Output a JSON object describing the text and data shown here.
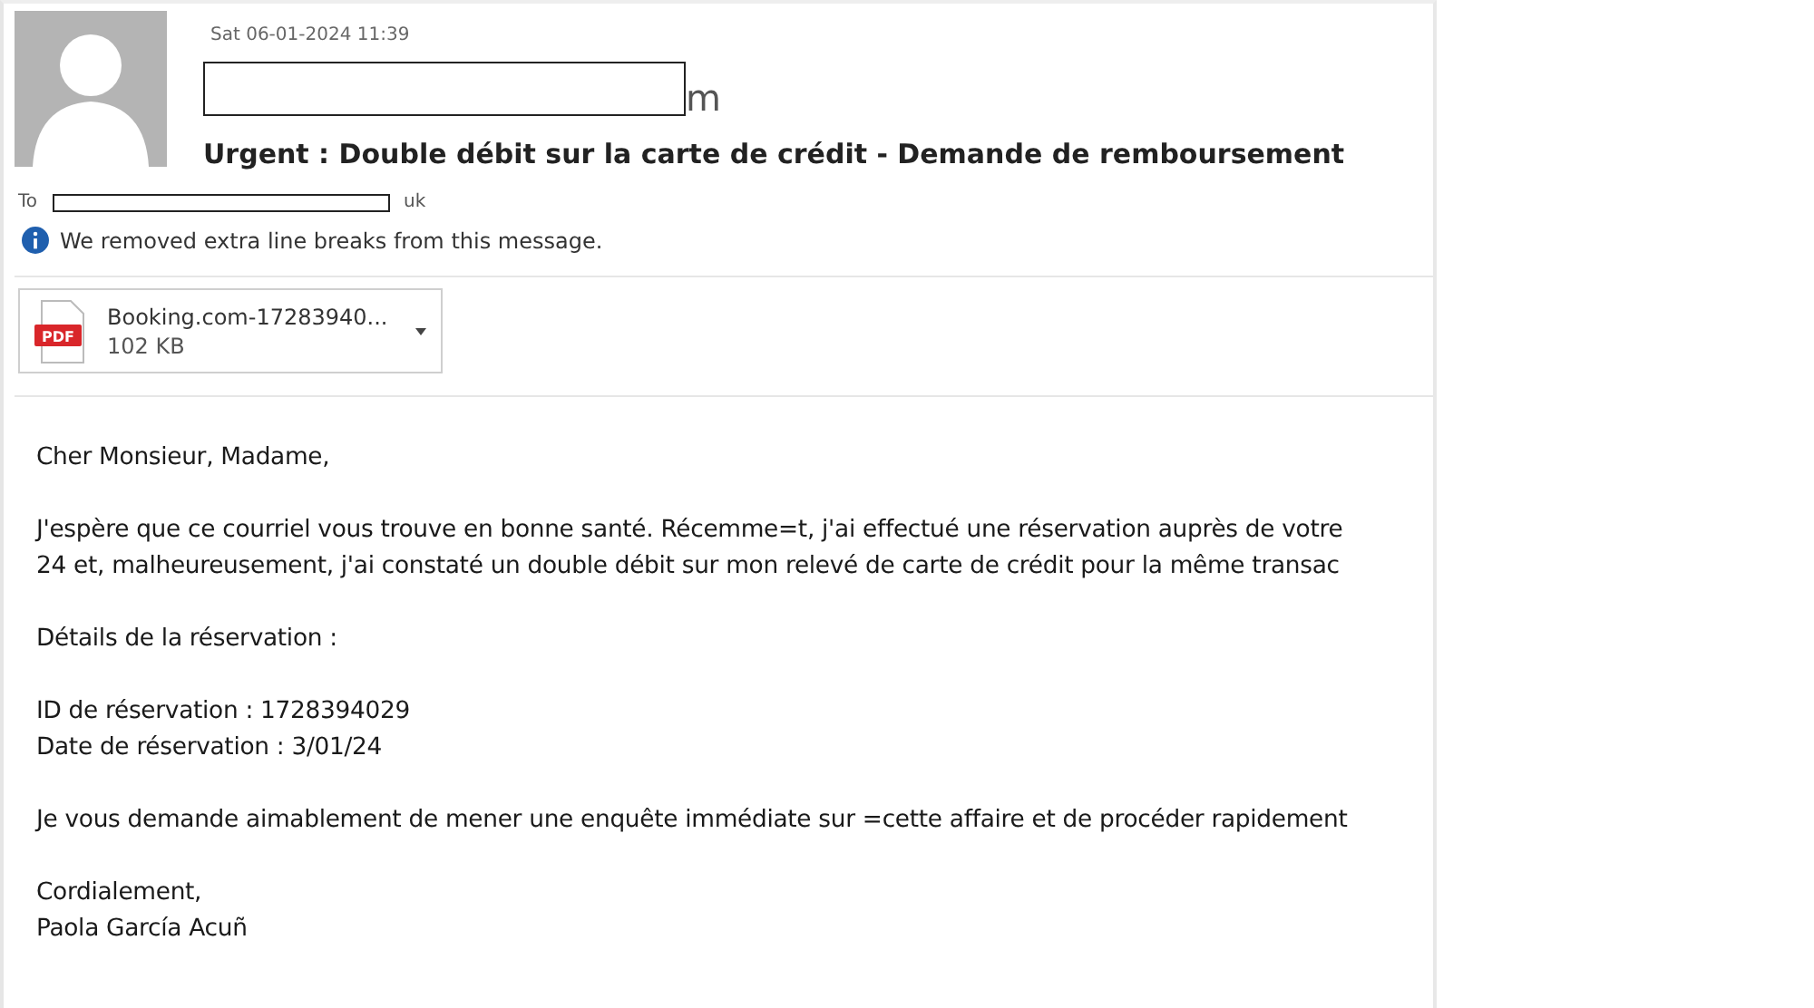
{
  "message": {
    "date": "Sat 06-01-2024 11:39",
    "sender_tail": "m",
    "subject": "Urgent : Double débit sur la carte de crédit - Demande de remboursement",
    "to_label": "To",
    "to_tail": "uk",
    "notice": "We removed extra line breaks from this message."
  },
  "attachment": {
    "type_label": "PDF",
    "name": "Booking.com-17283940...",
    "size": "102 KB"
  },
  "body": [
    {
      "lines": [
        "Cher Monsieur, Madame,"
      ]
    },
    {
      "lines": [
        "J'espère que ce courriel vous trouve en bonne santé. Récemme=t, j'ai effectué une réservation auprès de votre",
        "24 et, malheureusement, j'ai constaté un double débit sur mon relevé de carte de crédit pour la même transac"
      ]
    },
    {
      "lines": [
        "Détails de la réservation :"
      ]
    },
    {
      "lines": [
        "ID de réservation : 1728394029",
        "Date de réservation : 3/01/24"
      ]
    },
    {
      "lines": [
        "Je vous demande aimablement de mener une enquête immédiate sur =cette affaire et de procéder rapidement"
      ]
    },
    {
      "lines": [
        "Cordialement,",
        "Paola García Acuñ"
      ]
    }
  ]
}
